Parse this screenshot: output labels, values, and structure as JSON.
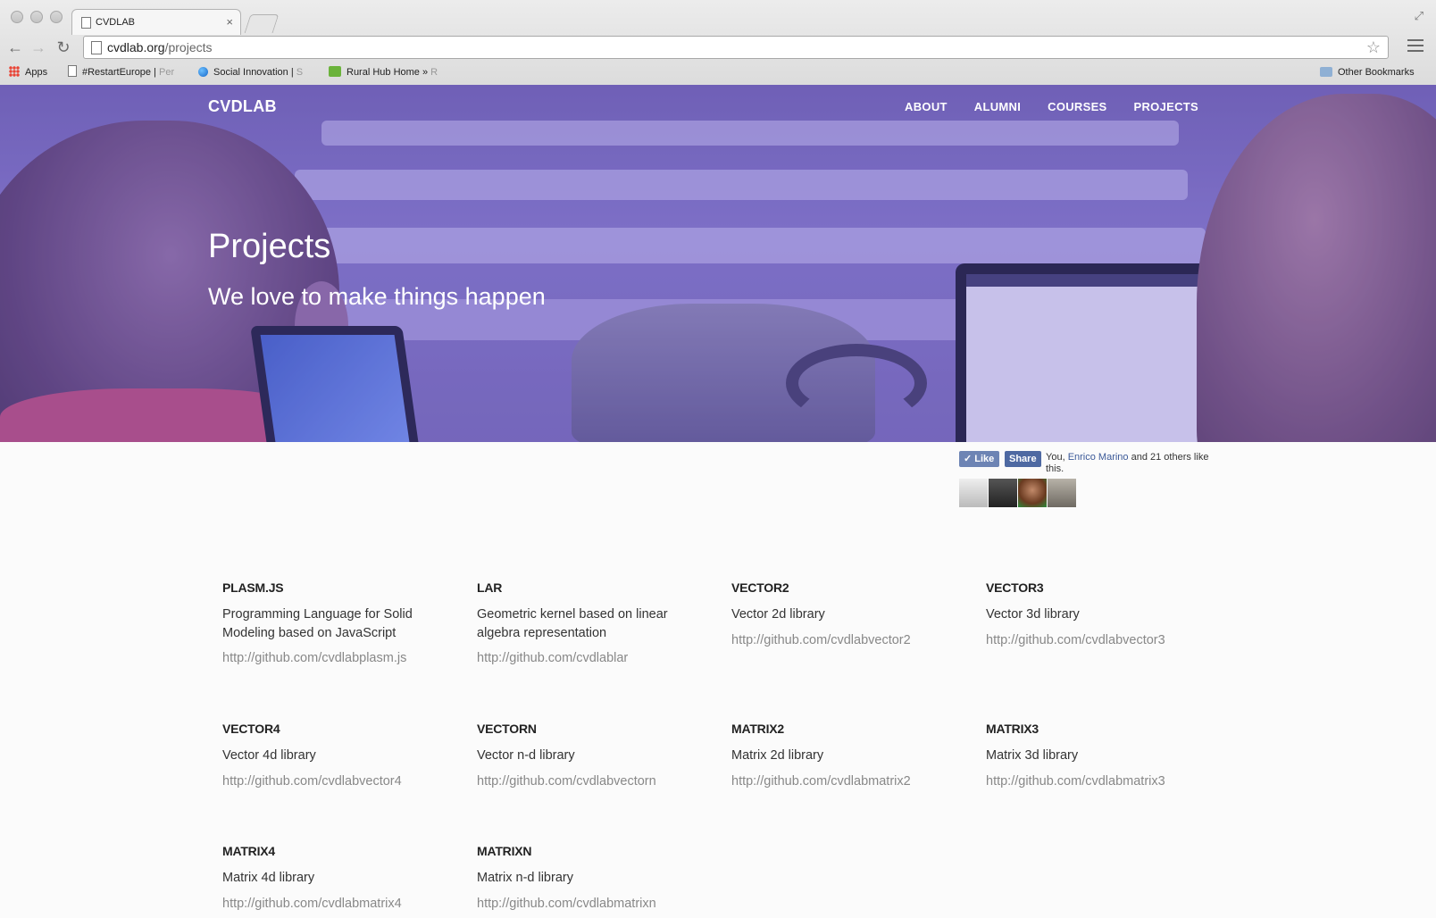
{
  "browser": {
    "tab_title": "CVDLAB",
    "tab_close": "×",
    "url_host": "cvdlab.org",
    "url_path": "/projects",
    "bookmarks": [
      {
        "label": "Apps",
        "faded": ""
      },
      {
        "label": "#RestartEurope | ",
        "faded": "Per"
      },
      {
        "label": "Social Innovation | ",
        "faded": "S"
      },
      {
        "label": "Rural Hub Home » ",
        "faded": "R"
      }
    ],
    "other_bookmarks": "Other Bookmarks"
  },
  "site": {
    "logo": "CVDLAB",
    "nav": [
      "ABOUT",
      "ALUMNI",
      "COURSES",
      "PROJECTS"
    ],
    "hero_title": "Projects",
    "hero_subtitle": "We love to make things happen"
  },
  "facebook": {
    "like_label": "Like",
    "share_label": "Share",
    "text_prefix": "You, ",
    "friend_name": "Enrico Marino",
    "text_suffix": " and 21 others like this."
  },
  "projects": [
    {
      "name": "PLASM.JS",
      "description": "Programming Language for Solid Modeling based on JavaScript",
      "link": "http://github.com/cvdlabplasm.js"
    },
    {
      "name": "LAR",
      "description": "Geometric kernel based on linear algebra representation",
      "link": "http://github.com/cvdlablar"
    },
    {
      "name": "VECTOR2",
      "description": "Vector 2d library",
      "link": "http://github.com/cvdlabvector2"
    },
    {
      "name": "VECTOR3",
      "description": "Vector 3d library",
      "link": "http://github.com/cvdlabvector3"
    },
    {
      "name": "VECTOR4",
      "description": "Vector 4d library",
      "link": "http://github.com/cvdlabvector4"
    },
    {
      "name": "VECTORN",
      "description": "Vector n-d library",
      "link": "http://github.com/cvdlabvectorn"
    },
    {
      "name": "MATRIX2",
      "description": "Matrix 2d library",
      "link": "http://github.com/cvdlabmatrix2"
    },
    {
      "name": "MATRIX3",
      "description": "Matrix 3d library",
      "link": "http://github.com/cvdlabmatrix3"
    },
    {
      "name": "MATRIX4",
      "description": "Matrix 4d library",
      "link": "http://github.com/cvdlabmatrix4"
    },
    {
      "name": "MATRIXN",
      "description": "Matrix n-d library",
      "link": "http://github.com/cvdlabmatrixn"
    }
  ]
}
